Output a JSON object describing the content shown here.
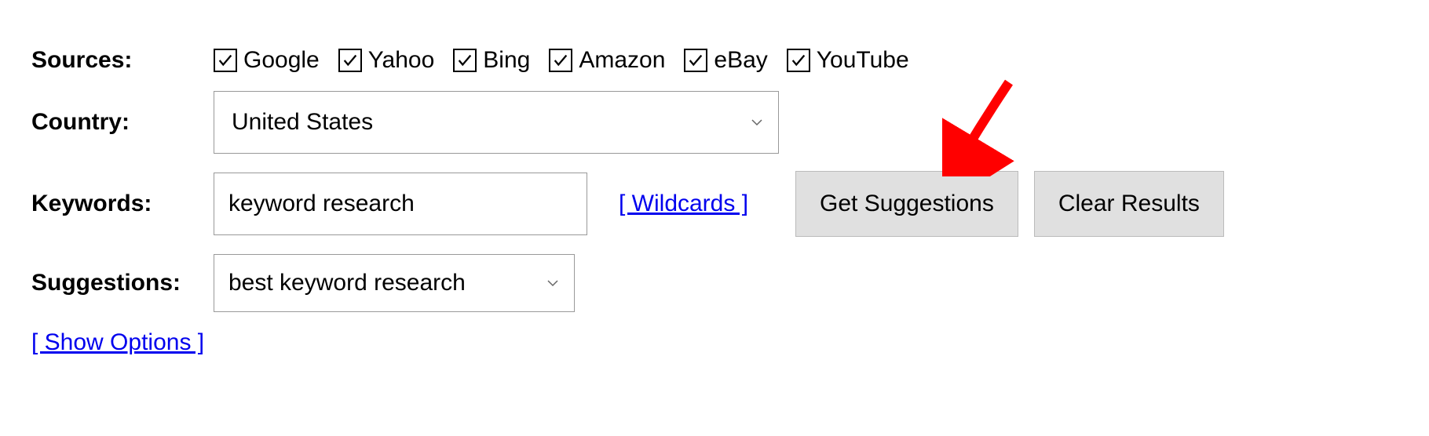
{
  "labels": {
    "sources": "Sources:",
    "country": "Country:",
    "keywords": "Keywords:",
    "suggestions": "Suggestions:"
  },
  "sources": [
    {
      "key": "google",
      "label": "Google",
      "checked": true
    },
    {
      "key": "yahoo",
      "label": "Yahoo",
      "checked": true
    },
    {
      "key": "bing",
      "label": "Bing",
      "checked": true
    },
    {
      "key": "amazon",
      "label": "Amazon",
      "checked": true
    },
    {
      "key": "ebay",
      "label": "eBay",
      "checked": true
    },
    {
      "key": "youtube",
      "label": "YouTube",
      "checked": true
    }
  ],
  "country": {
    "selected": "United States"
  },
  "keywords": {
    "value": "keyword research"
  },
  "links": {
    "wildcards": "[ Wildcards ]",
    "show_options": "[ Show Options ]"
  },
  "buttons": {
    "get_suggestions": "Get Suggestions",
    "clear_results": "Clear Results"
  },
  "suggestions": {
    "selected": "best keyword research"
  }
}
